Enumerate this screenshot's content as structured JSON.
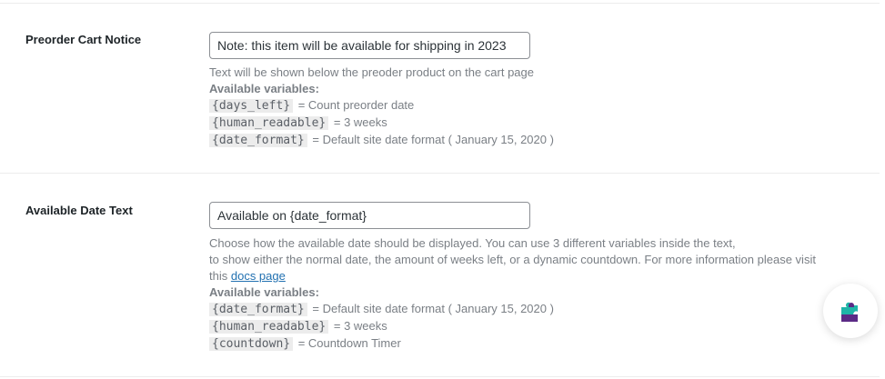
{
  "preorder_cart_notice": {
    "label": "Preorder Cart Notice",
    "value": "Note: this item will be available for shipping in 2023",
    "description": "Text will be shown below the preoder product on the cart page",
    "variables_heading": "Available variables:",
    "variables": [
      {
        "code": "{days_left}",
        "desc": "= Count preorder date"
      },
      {
        "code": "{human_readable}",
        "desc": "= 3 weeks"
      },
      {
        "code": "{date_format}",
        "desc": "= Default site date format ( January 15, 2020 )"
      }
    ]
  },
  "available_date_text": {
    "label": "Available Date Text",
    "value": "Available on {date_format}",
    "description_line1": "Choose how the available date should be displayed. You can use 3 different variables inside the text,",
    "description_line2": "to show either the normal date, the amount of weeks left, or a dynamic countdown. For more information please visit",
    "description_line3_prefix": "this",
    "docs_link": "docs page",
    "variables_heading": "Available variables:",
    "variables": [
      {
        "code": "{date_format}",
        "desc": "= Default site date format ( January 15, 2020 )"
      },
      {
        "code": "{human_readable}",
        "desc": "= 3 weeks"
      },
      {
        "code": "{countdown}",
        "desc": "= Countdown Timer"
      }
    ]
  },
  "help_widget": {
    "icon": "puzzle-piece-icon"
  },
  "colors": {
    "link": "#2271b1",
    "icon_teal": "#1fb5a8",
    "icon_purple": "#5b2a86"
  }
}
